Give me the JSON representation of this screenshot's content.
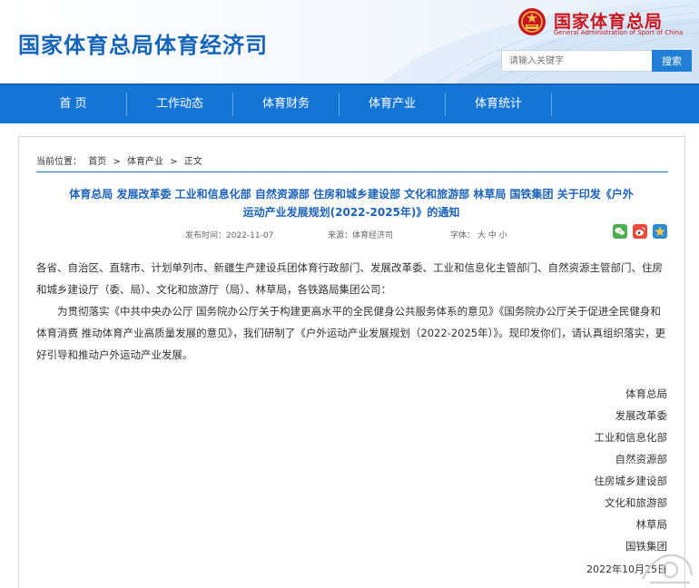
{
  "header": {
    "site_title": "国家体育总局体育经济司",
    "logo_cn": "国家体育总局",
    "logo_en": "General Administration of Sport of China",
    "emblem_icon": "national-emblem-icon",
    "search_placeholder": "请输入关键字",
    "search_button": "搜索"
  },
  "nav": {
    "items": [
      {
        "label": "首 页"
      },
      {
        "label": "工作动态"
      },
      {
        "label": "体育财务"
      },
      {
        "label": "体育产业"
      },
      {
        "label": "体育统计"
      }
    ]
  },
  "breadcrumb": {
    "prefix": "当前位置：",
    "items": [
      "首页",
      "体育产业",
      "正文"
    ],
    "separator": ">"
  },
  "article": {
    "title_line1": "体育总局 发展改革委 工业和信息化部 自然资源部 住房和城乡建设部 文化和旅游部 林草局 国铁集团 关于印发《户外",
    "title_line2": "运动产业发展规划(2022-2025年)》的通知",
    "publish_time": "发布时间：2022-11-07",
    "source": "来源：体育经济司",
    "font_label": "字体：",
    "font_sizes": [
      "大",
      "中",
      "小"
    ],
    "share_icons": [
      "wechat-icon",
      "weibo-icon",
      "qzone-icon"
    ],
    "paragraph1": "各省、自治区、直辖市、计划单列市、新疆生产建设兵团体育行政部门、发展改革委、工业和信息化主管部门、自然资源主管部门、住房和城乡建设厅（委、局）、文化和旅游厅（局）、林草局，各铁路局集团公司：",
    "paragraph2": "为贯彻落实《中共中央办公厅 国务院办公厅关于构建更高水平的全民健身公共服务体系的意见》《国务院办公厅关于促进全民健身和体育消费 推动体育产业高质量发展的意见》，我们研制了《户外运动产业发展规划（2022-2025年）》。现印发你们，请认真组织落实，更好引导和推动户外运动产业发展。",
    "signatures": [
      "体育总局",
      "发展改革委",
      "工业和信息化部",
      "自然资源部",
      "住房城乡建设部",
      "文化和旅游部",
      "林草局",
      "国铁集团",
      "2022年10月25日"
    ]
  },
  "colors": {
    "brand_blue": "#1575d5",
    "title_blue": "#1565b8",
    "logo_red": "#c8161d"
  }
}
